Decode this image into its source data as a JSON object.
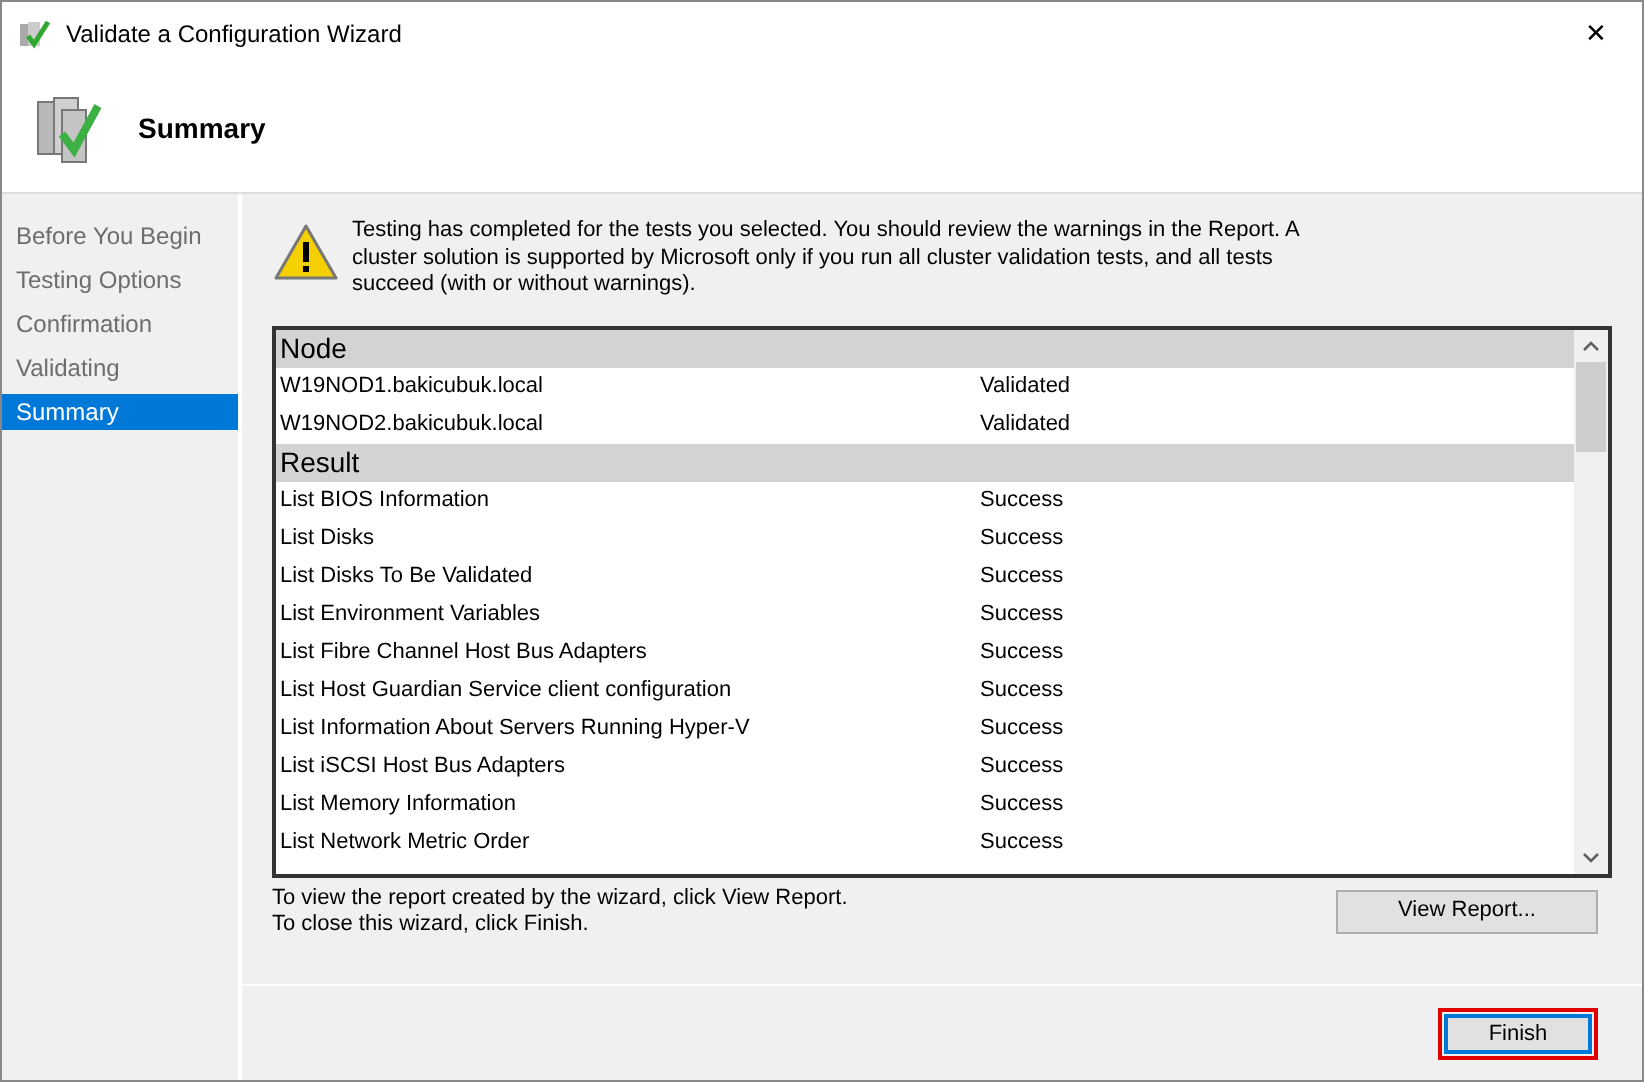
{
  "window": {
    "title": "Validate a Configuration Wizard",
    "close": "✕"
  },
  "header": {
    "title": "Summary"
  },
  "sidebar": {
    "items": [
      {
        "label": "Before You Begin",
        "selected": false
      },
      {
        "label": "Testing Options",
        "selected": false
      },
      {
        "label": "Confirmation",
        "selected": false
      },
      {
        "label": "Validating",
        "selected": false
      },
      {
        "label": "Summary",
        "selected": true
      }
    ]
  },
  "message": "Testing has completed for the tests you selected. You should review the warnings in the Report.  A cluster solution is supported by Microsoft only if you run all cluster validation tests, and all tests succeed (with or without warnings).",
  "report": {
    "sections": [
      {
        "title": "Node",
        "rows": [
          {
            "name": "W19NOD1.bakicubuk.local",
            "status": "Validated"
          },
          {
            "name": "W19NOD2.bakicubuk.local",
            "status": "Validated"
          }
        ]
      },
      {
        "title": "Result",
        "rows": [
          {
            "name": "List BIOS Information",
            "status": "Success"
          },
          {
            "name": "List Disks",
            "status": "Success"
          },
          {
            "name": "List Disks To Be Validated",
            "status": "Success"
          },
          {
            "name": "List Environment Variables",
            "status": "Success"
          },
          {
            "name": "List Fibre Channel Host Bus Adapters",
            "status": "Success"
          },
          {
            "name": "List Host Guardian Service client configuration",
            "status": "Success"
          },
          {
            "name": "List Information About Servers Running Hyper-V",
            "status": "Success"
          },
          {
            "name": "List iSCSI Host Bus Adapters",
            "status": "Success"
          },
          {
            "name": "List Memory Information",
            "status": "Success"
          },
          {
            "name": "List Network Metric Order",
            "status": "Success"
          }
        ]
      }
    ]
  },
  "hints": [
    "To view the report created by the wizard, click View Report.",
    "To close this wizard, click Finish."
  ],
  "view_report_button": "View Report...",
  "finish_button": {
    "label": "Finish",
    "highlighted": true
  }
}
